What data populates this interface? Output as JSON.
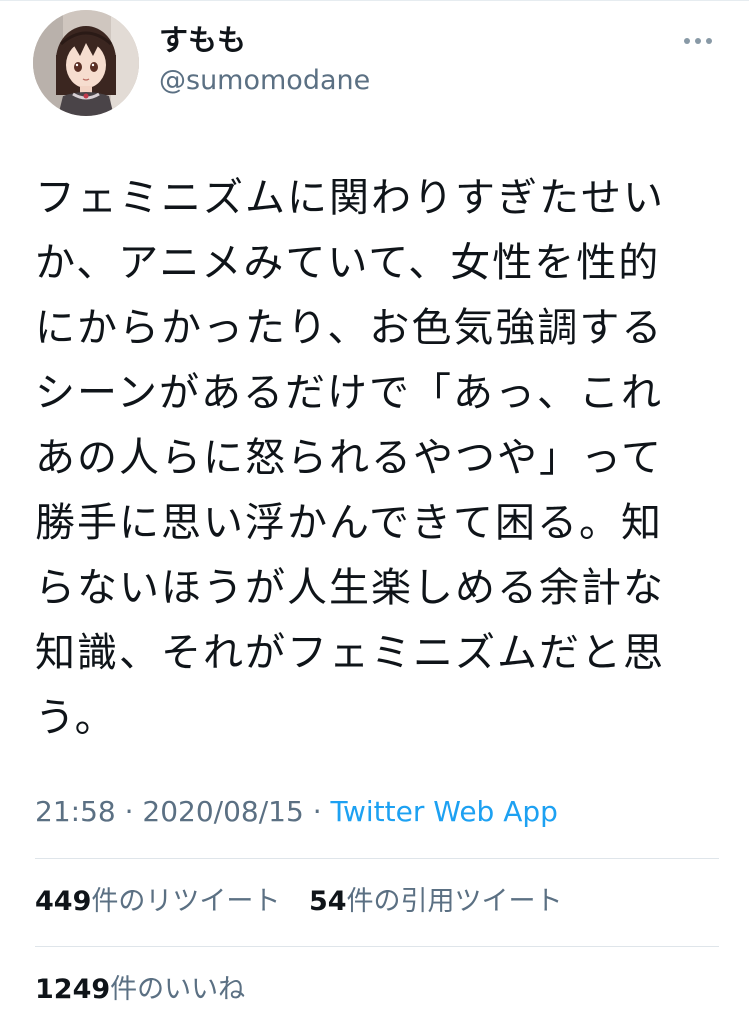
{
  "tweet": {
    "author": {
      "display_name": "すもも",
      "handle": "@sumomodane"
    },
    "text": "フェミニズムに関わりすぎたせい\nか、アニメみていて、女性を性的\nにからかったり、お色気強調する\nシーンがあるだけで「あっ、これ\nあの人らに怒られるやつや」って\n勝手に思い浮かんできて困る。知\nらないほうが人生楽しめる余計な\n知識、それがフェミニズムだと思\nう。",
    "time": "21:58",
    "separator": "·",
    "date": "2020/08/15",
    "source": "Twitter Web App",
    "retweets": {
      "count": "449",
      "label": "件のリツイート"
    },
    "quotes": {
      "count": "54",
      "label": "件の引用ツイート"
    },
    "likes": {
      "count": "1249",
      "label": "件のいいね"
    }
  },
  "icons": {
    "more": "more-horizontal-icon"
  },
  "colors": {
    "text_primary": "#0f1419",
    "text_secondary": "#5b7083",
    "link": "#1da1f2",
    "divider": "#dfe5ea"
  }
}
